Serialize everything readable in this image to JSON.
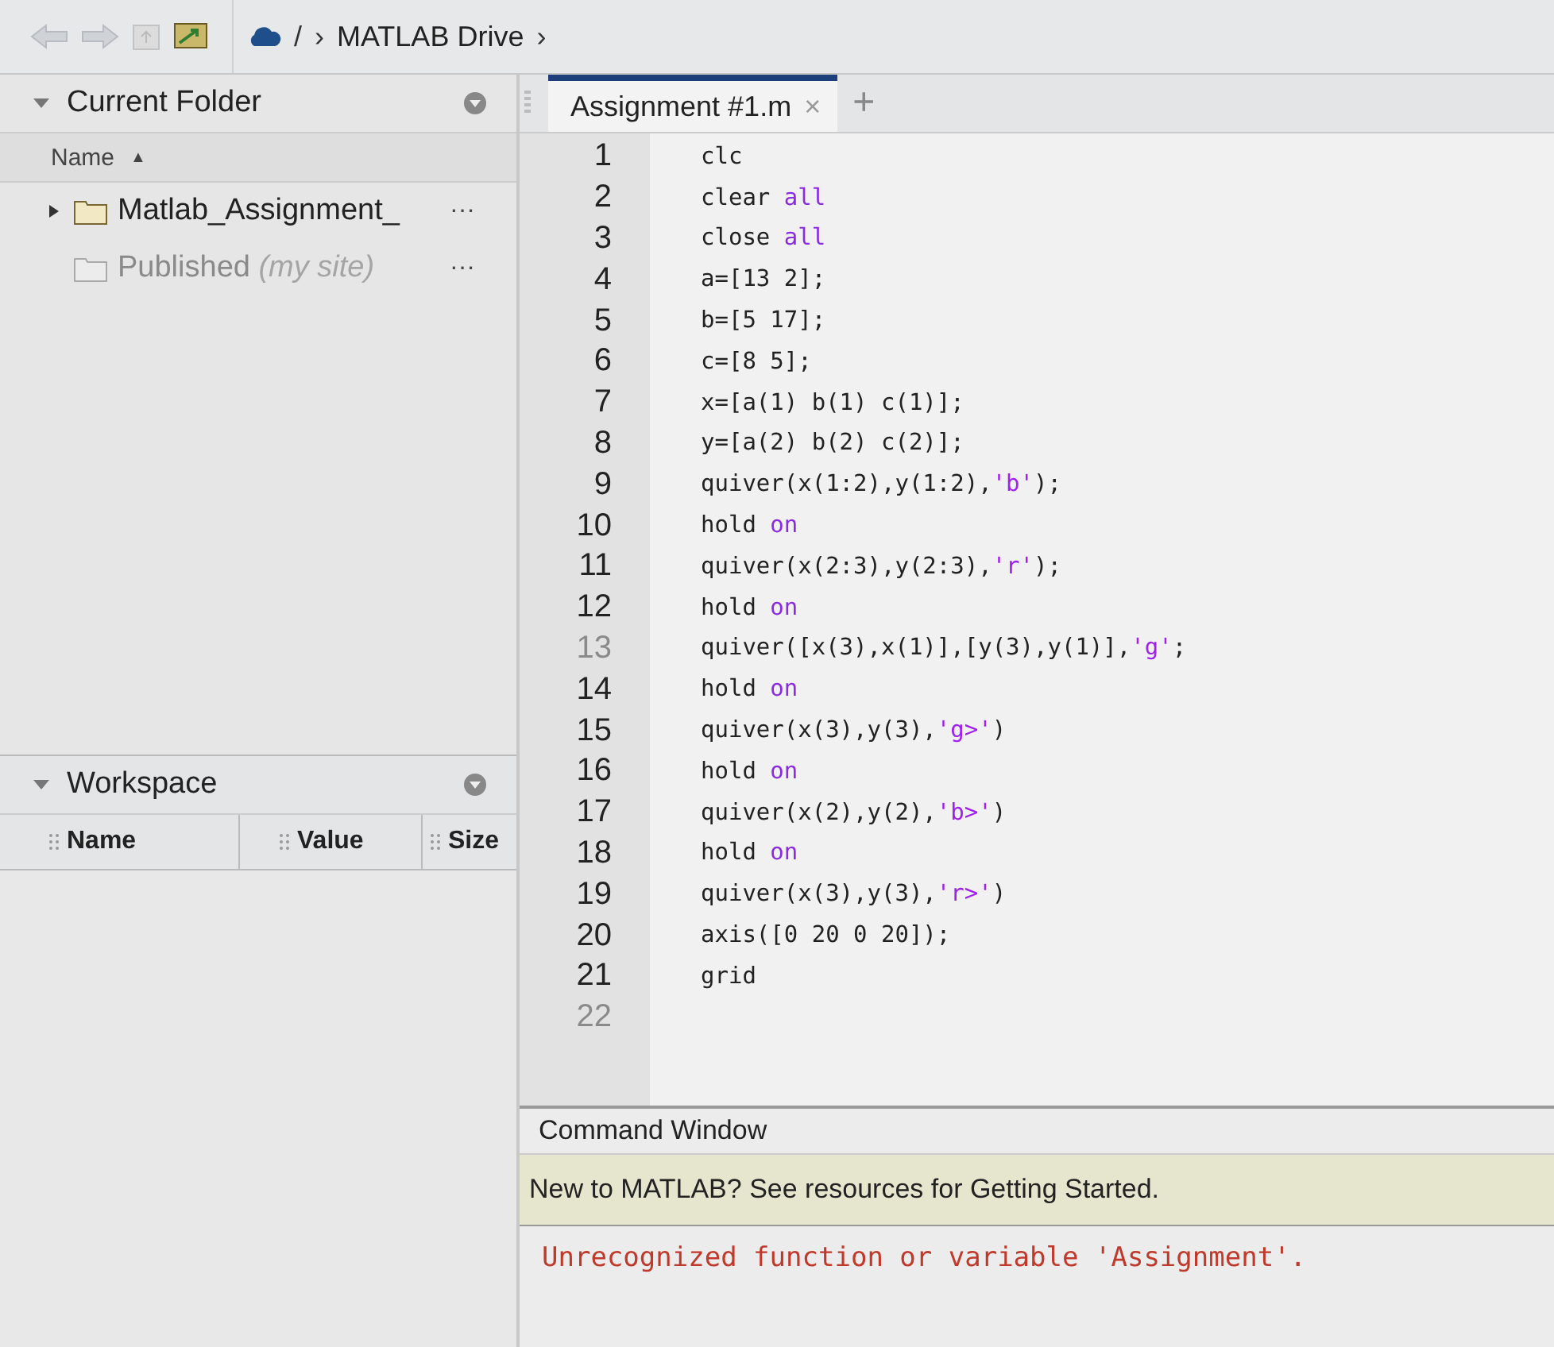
{
  "toolbar": {
    "path_separator": "/",
    "path_arrow": "›",
    "location": "MATLAB Drive",
    "location_arrow": "›"
  },
  "current_folder": {
    "title": "Current Folder",
    "column": "Name",
    "sort_arrow": "▲",
    "items": [
      {
        "name": "Matlab_Assignment_",
        "expandable": true,
        "dim": false,
        "more": "···"
      },
      {
        "name": "Published",
        "suffix": "(my site)",
        "expandable": false,
        "dim": true,
        "more": "···"
      }
    ]
  },
  "workspace": {
    "title": "Workspace",
    "columns": [
      "Name",
      "Value",
      "Size"
    ]
  },
  "editor": {
    "tabs": [
      {
        "label": "Assignment #1.m",
        "selected": true,
        "close": "×"
      }
    ],
    "new_tab": "+",
    "lines": [
      {
        "n": "1",
        "dim": false,
        "tokens": [
          {
            "t": "clc",
            "kind": "plain"
          }
        ]
      },
      {
        "n": "2",
        "dim": false,
        "tokens": [
          {
            "t": "clear ",
            "kind": "plain"
          },
          {
            "t": "all",
            "kind": "keyword"
          }
        ]
      },
      {
        "n": "3",
        "dim": false,
        "tokens": [
          {
            "t": "close ",
            "kind": "plain"
          },
          {
            "t": "all",
            "kind": "keyword"
          }
        ]
      },
      {
        "n": "4",
        "dim": false,
        "tokens": [
          {
            "t": "a=[13 2];",
            "kind": "plain"
          }
        ]
      },
      {
        "n": "5",
        "dim": false,
        "tokens": [
          {
            "t": "b=[5 17];",
            "kind": "plain"
          }
        ]
      },
      {
        "n": "6",
        "dim": false,
        "tokens": [
          {
            "t": "c=[8 5];",
            "kind": "plain"
          }
        ]
      },
      {
        "n": "7",
        "dim": false,
        "tokens": [
          {
            "t": "x=[a(1) b(1) c(1)];",
            "kind": "plain"
          }
        ]
      },
      {
        "n": "8",
        "dim": false,
        "tokens": [
          {
            "t": "y=[a(2) b(2) c(2)];",
            "kind": "plain"
          }
        ]
      },
      {
        "n": "9",
        "dim": false,
        "tokens": [
          {
            "t": "quiver(x(1:2),y(1:2),",
            "kind": "plain"
          },
          {
            "t": "'b'",
            "kind": "string"
          },
          {
            "t": ");",
            "kind": "plain"
          }
        ]
      },
      {
        "n": "10",
        "dim": false,
        "tokens": [
          {
            "t": "hold ",
            "kind": "plain"
          },
          {
            "t": "on",
            "kind": "keyword"
          }
        ]
      },
      {
        "n": "11",
        "dim": false,
        "tokens": [
          {
            "t": "quiver(x(2:3),y(2:3),",
            "kind": "plain"
          },
          {
            "t": "'r'",
            "kind": "string"
          },
          {
            "t": ");",
            "kind": "plain"
          }
        ]
      },
      {
        "n": "12",
        "dim": false,
        "tokens": [
          {
            "t": "hold ",
            "kind": "plain"
          },
          {
            "t": "on",
            "kind": "keyword"
          }
        ]
      },
      {
        "n": "13",
        "dim": true,
        "tokens": [
          {
            "t": "quiver([x(3),x(1)],[y(3),y(1)],",
            "kind": "plain"
          },
          {
            "t": "'g'",
            "kind": "string"
          },
          {
            "t": ";",
            "kind": "plain"
          }
        ]
      },
      {
        "n": "14",
        "dim": false,
        "tokens": [
          {
            "t": "hold ",
            "kind": "plain"
          },
          {
            "t": "on",
            "kind": "keyword"
          }
        ]
      },
      {
        "n": "15",
        "dim": false,
        "tokens": [
          {
            "t": "quiver(x(3),y(3),",
            "kind": "plain"
          },
          {
            "t": "'g>'",
            "kind": "string"
          },
          {
            "t": ")",
            "kind": "plain"
          }
        ]
      },
      {
        "n": "16",
        "dim": false,
        "tokens": [
          {
            "t": "hold ",
            "kind": "plain"
          },
          {
            "t": "on",
            "kind": "keyword"
          }
        ]
      },
      {
        "n": "17",
        "dim": false,
        "tokens": [
          {
            "t": "quiver(x(2),y(2),",
            "kind": "plain"
          },
          {
            "t": "'b>'",
            "kind": "string"
          },
          {
            "t": ")",
            "kind": "plain"
          }
        ]
      },
      {
        "n": "18",
        "dim": false,
        "tokens": [
          {
            "t": "hold ",
            "kind": "plain"
          },
          {
            "t": "on",
            "kind": "keyword"
          }
        ]
      },
      {
        "n": "19",
        "dim": false,
        "tokens": [
          {
            "t": "quiver(x(3),y(3),",
            "kind": "plain"
          },
          {
            "t": "'r>'",
            "kind": "string"
          },
          {
            "t": ")",
            "kind": "plain"
          }
        ]
      },
      {
        "n": "20",
        "dim": false,
        "tokens": [
          {
            "t": "axis([0 20 0 20]);",
            "kind": "plain"
          }
        ]
      },
      {
        "n": "21",
        "dim": false,
        "tokens": [
          {
            "t": "grid",
            "kind": "plain"
          }
        ]
      },
      {
        "n": "22",
        "dim": true
      }
    ]
  },
  "command_window": {
    "title": "Command Window",
    "banner": "New to MATLAB? See resources for Getting Started.",
    "output": [
      {
        "text": "Unrecognized function or variable 'Assignment'.",
        "kind": "error"
      }
    ]
  }
}
